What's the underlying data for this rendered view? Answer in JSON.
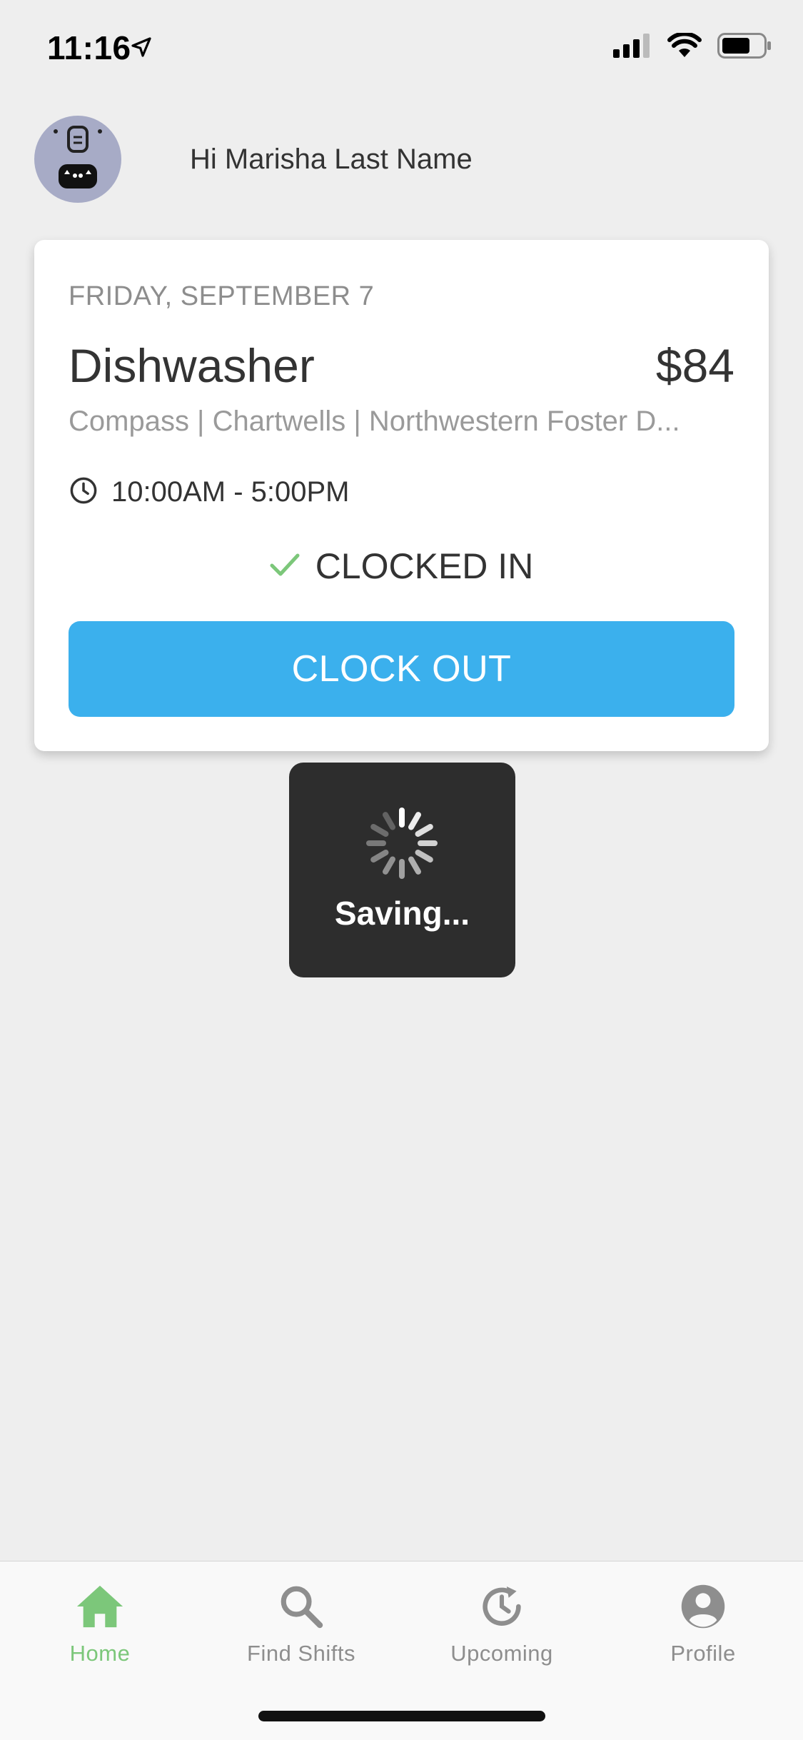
{
  "status_bar": {
    "time": "11:16"
  },
  "greeting": {
    "text": "Hi Marisha Last Name"
  },
  "shift_card": {
    "date": "FRIDAY, SEPTEMBER 7",
    "role": "Dishwasher",
    "pay": "$84",
    "location": "Compass | Chartwells | Northwestern Foster D...",
    "time_range": "10:00AM - 5:00PM",
    "status": "CLOCKED IN",
    "action_label": "CLOCK OUT"
  },
  "toast": {
    "text": "Saving..."
  },
  "tab_bar": {
    "active_index": 0,
    "tabs": [
      {
        "label": "Home",
        "icon": "home-icon"
      },
      {
        "label": "Find Shifts",
        "icon": "search-icon"
      },
      {
        "label": "Upcoming",
        "icon": "history-clock-icon"
      },
      {
        "label": "Profile",
        "icon": "account-circle-icon"
      }
    ]
  },
  "colors": {
    "accent_blue": "#3bb0ed",
    "active_green": "#7cc77a",
    "background": "#eeeeee"
  }
}
